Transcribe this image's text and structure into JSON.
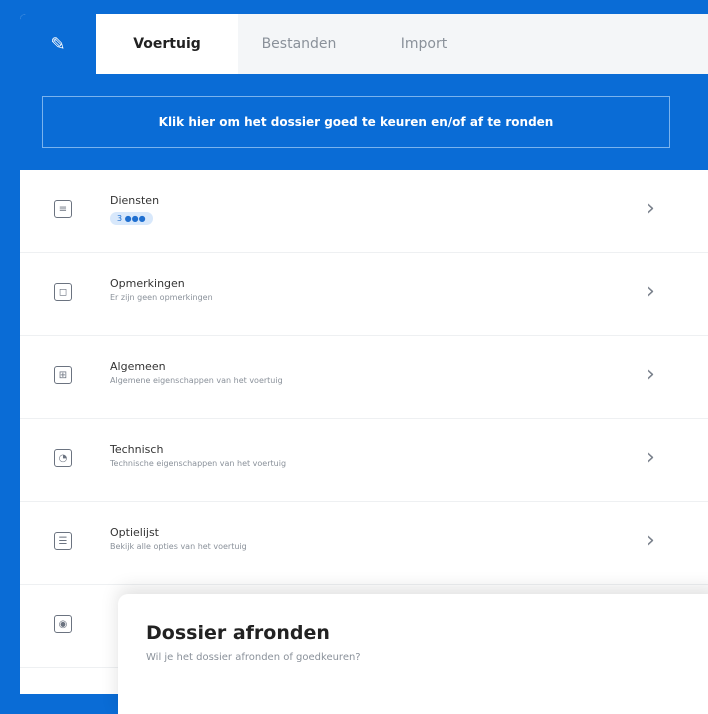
{
  "tabs": {
    "edit_icon": "pencil-icon",
    "items": [
      {
        "label": "Voertuig",
        "active": true
      },
      {
        "label": "Bestanden",
        "active": false
      },
      {
        "label": "Import",
        "active": false
      }
    ]
  },
  "banner": {
    "label": "Klik hier om het dossier goed te keuren en/of af te ronden"
  },
  "list": {
    "items": [
      {
        "title": "Diensten",
        "subtitle": "",
        "badge": "3 ●●●",
        "icon": "document-icon"
      },
      {
        "title": "Opmerkingen",
        "subtitle": "Er zijn geen opmerkingen",
        "icon": "comment-icon"
      },
      {
        "title": "Algemeen",
        "subtitle": "Algemene eigenschappen van het voertuig",
        "icon": "grid-icon"
      },
      {
        "title": "Technisch",
        "subtitle": "Technische eigenschappen van het voertuig",
        "icon": "gauge-icon"
      },
      {
        "title": "Optielijst",
        "subtitle": "Bekijk alle opties van het voertuig",
        "icon": "list-icon"
      },
      {
        "title": "",
        "subtitle": "",
        "icon": "car-icon"
      }
    ]
  },
  "modal": {
    "title": "Dossier afronden",
    "subtitle": "Wil je het dossier afronden of goedkeuren?"
  },
  "colors": {
    "brand": "#0a6cd6"
  }
}
